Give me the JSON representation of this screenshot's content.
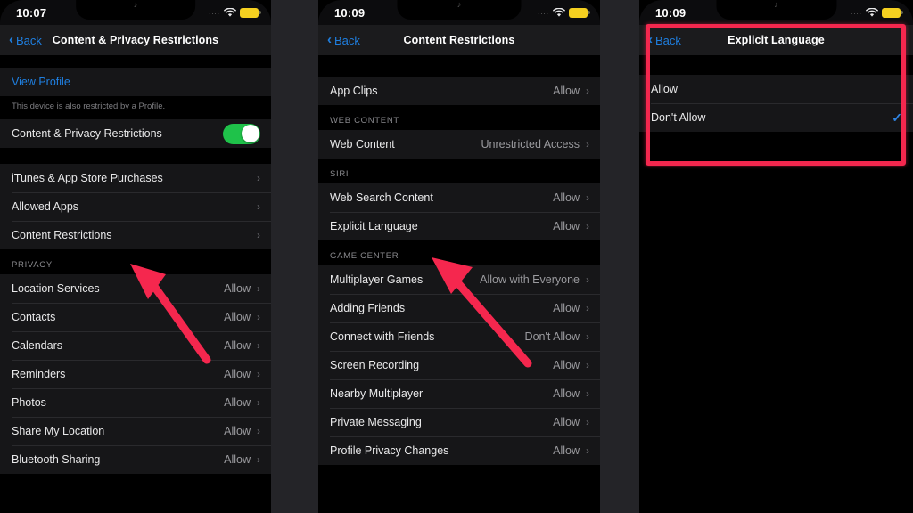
{
  "screen": {
    "background_color": "#242428",
    "accent_blue": "#1f7fe0",
    "annotation_red": "#f5274e",
    "toggle_green": "#1fc24a",
    "battery_yellow": "#f5d020"
  },
  "panels": [
    {
      "id": "content-privacy-restrictions",
      "status_bar": {
        "time": "10:07",
        "dots": "....",
        "wifi_icon": "wifi-icon",
        "battery_icon": "battery-icon",
        "notch_glyph": "♪"
      },
      "nav": {
        "back_label": "Back",
        "back_chevron": "‹",
        "title": "Content & Privacy Restrictions"
      },
      "sections": [
        {
          "type": "group",
          "rows": [
            {
              "label": "View Profile",
              "style": "link",
              "value": "",
              "accessory": "none"
            }
          ]
        },
        {
          "type": "footnote",
          "text": "This device is also restricted by a Profile."
        },
        {
          "type": "group",
          "rows": [
            {
              "label": "Content & Privacy Restrictions",
              "value": "",
              "accessory": "toggle",
              "toggle_on": true
            }
          ]
        },
        {
          "type": "gap",
          "height": 18
        },
        {
          "type": "group",
          "rows": [
            {
              "label": "iTunes & App Store Purchases",
              "value": "",
              "accessory": "chevron"
            },
            {
              "label": "Allowed Apps",
              "value": "",
              "accessory": "chevron"
            },
            {
              "label": "Content Restrictions",
              "value": "",
              "accessory": "chevron"
            }
          ]
        },
        {
          "type": "header",
          "text": "PRIVACY"
        },
        {
          "type": "group",
          "rows": [
            {
              "label": "Location Services",
              "value": "Allow",
              "accessory": "chevron"
            },
            {
              "label": "Contacts",
              "value": "Allow",
              "accessory": "chevron"
            },
            {
              "label": "Calendars",
              "value": "Allow",
              "accessory": "chevron"
            },
            {
              "label": "Reminders",
              "value": "Allow",
              "accessory": "chevron"
            },
            {
              "label": "Photos",
              "value": "Allow",
              "accessory": "chevron"
            },
            {
              "label": "Share My Location",
              "value": "Allow",
              "accessory": "chevron"
            },
            {
              "label": "Bluetooth Sharing",
              "value": "Allow",
              "accessory": "chevron"
            }
          ]
        }
      ]
    },
    {
      "id": "content-restrictions",
      "status_bar": {
        "time": "10:09",
        "dots": "....",
        "wifi_icon": "wifi-icon",
        "battery_icon": "battery-icon",
        "notch_glyph": "♪"
      },
      "nav": {
        "back_label": "Back",
        "back_chevron": "‹",
        "title": "Content Restrictions"
      },
      "sections": [
        {
          "type": "gap",
          "height": 18
        },
        {
          "type": "group",
          "rows": [
            {
              "label": "App Clips",
              "value": "Allow",
              "accessory": "chevron"
            }
          ]
        },
        {
          "type": "header",
          "text": "WEB CONTENT"
        },
        {
          "type": "group",
          "rows": [
            {
              "label": "Web Content",
              "value": "Unrestricted Access",
              "accessory": "chevron"
            }
          ]
        },
        {
          "type": "header",
          "text": "SIRI"
        },
        {
          "type": "group",
          "rows": [
            {
              "label": "Web Search Content",
              "value": "Allow",
              "accessory": "chevron"
            },
            {
              "label": "Explicit Language",
              "value": "Allow",
              "accessory": "chevron"
            }
          ]
        },
        {
          "type": "header",
          "text": "GAME CENTER"
        },
        {
          "type": "group",
          "rows": [
            {
              "label": "Multiplayer Games",
              "value": "Allow with Everyone",
              "accessory": "chevron"
            },
            {
              "label": "Adding Friends",
              "value": "Allow",
              "accessory": "chevron"
            },
            {
              "label": "Connect with Friends",
              "value": "Don't Allow",
              "accessory": "chevron"
            },
            {
              "label": "Screen Recording",
              "value": "Allow",
              "accessory": "chevron"
            },
            {
              "label": "Nearby Multiplayer",
              "value": "Allow",
              "accessory": "chevron"
            },
            {
              "label": "Private Messaging",
              "value": "Allow",
              "accessory": "chevron"
            },
            {
              "label": "Profile Privacy Changes",
              "value": "Allow",
              "accessory": "chevron"
            }
          ]
        }
      ]
    },
    {
      "id": "explicit-language",
      "status_bar": {
        "time": "10:09",
        "dots": "....",
        "wifi_icon": "wifi-icon",
        "battery_icon": "battery-icon",
        "notch_glyph": "♪"
      },
      "nav": {
        "back_label": "Back",
        "back_chevron": "‹",
        "title": "Explicit Language"
      },
      "sections": [
        {
          "type": "gap",
          "height": 16
        },
        {
          "type": "group",
          "rows": [
            {
              "label": "Allow",
              "value": "",
              "accessory": "none",
              "selected": false
            },
            {
              "label": "Don't Allow",
              "value": "",
              "accessory": "check",
              "selected": true
            }
          ]
        },
        {
          "type": "gap",
          "height": 30
        }
      ]
    }
  ],
  "annotations": {
    "arrows": [
      {
        "name": "arrow-to-content-restrictions",
        "target": "Content Restrictions"
      },
      {
        "name": "arrow-to-explicit-language",
        "target": "Explicit Language"
      }
    ],
    "highlight_box": {
      "name": "highlight-explicit-language-screen",
      "color": "#f5274e"
    }
  }
}
